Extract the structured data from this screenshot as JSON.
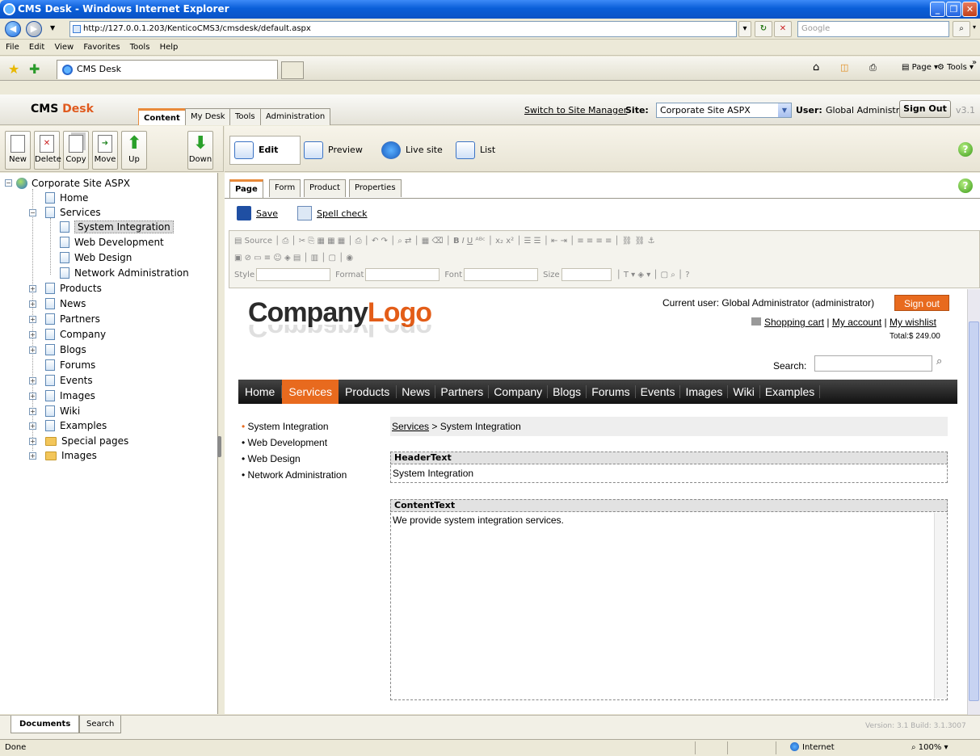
{
  "window": {
    "title": "CMS Desk - Windows Internet Explorer"
  },
  "browser": {
    "url": "http://127.0.0.1.203/KenticoCMS3/cmsdesk/default.aspx",
    "search_placeholder": "Google",
    "menu": [
      "File",
      "Edit",
      "View",
      "Favorites",
      "Tools",
      "Help"
    ],
    "tab_title": "CMS Desk",
    "cmd_page": "Page",
    "cmd_tools": "Tools"
  },
  "cms": {
    "logo_a": "CMS",
    "logo_b": "Desk",
    "tabs": [
      "Content",
      "My Desk",
      "Tools",
      "Administration"
    ],
    "switch_link": "Switch to Site Manager",
    "site_label": "Site:",
    "site_value": "Corporate Site ASPX",
    "user_label": "User:",
    "user_value": "Global Administrator",
    "sign_out": "Sign Out",
    "version_short": "v3.1"
  },
  "toolbar": {
    "buttons": [
      "New",
      "Delete",
      "Copy",
      "Move",
      "Up",
      "Down"
    ],
    "modes": [
      "Edit",
      "Preview",
      "Live site",
      "List"
    ]
  },
  "tree": {
    "root": "Corporate Site ASPX",
    "home": "Home",
    "services": "Services",
    "services_children": [
      "System Integration",
      "Web Development",
      "Web Design",
      "Network Administration"
    ],
    "rest": [
      "Products",
      "News",
      "Partners",
      "Company",
      "Blogs",
      "Forums",
      "Events",
      "Images",
      "Wiki",
      "Examples",
      "Special pages",
      "Images"
    ]
  },
  "editor": {
    "tabs": [
      "Page",
      "Form",
      "Product",
      "Properties"
    ],
    "save": "Save",
    "spell": "Spell check",
    "source": "Source",
    "style": "Style",
    "format": "Format",
    "font": "Font",
    "size": "Size"
  },
  "site": {
    "logo_a": "Company",
    "logo_b": "Logo",
    "current_user": "Current user:  Global Administrator (administrator)",
    "sign_out": "Sign out",
    "cart": "Shopping cart",
    "account": "My account",
    "wishlist": "My wishlist",
    "total": "Total:$ 249.00",
    "search_label": "Search:",
    "nav": [
      "Home",
      "Services",
      "Products",
      "News",
      "Partners",
      "Company",
      "Blogs",
      "Forums",
      "Events",
      "Images",
      "Wiki",
      "Examples"
    ],
    "side_menu": [
      "System Integration",
      "Web Development",
      "Web Design",
      "Network Administration"
    ],
    "breadcrumb_link": "Services",
    "breadcrumb_rest": " > System Integration",
    "header_label": "HeaderText",
    "header_value": "System Integration",
    "content_label": "ContentText",
    "content_value": "We provide system integration services."
  },
  "bottom": {
    "tabs": [
      "Documents",
      "Search"
    ],
    "version": "Version: 3.1 Build: 3.1.3007"
  },
  "status": {
    "left": "Done",
    "zone": "Internet",
    "zoom": "100%"
  }
}
